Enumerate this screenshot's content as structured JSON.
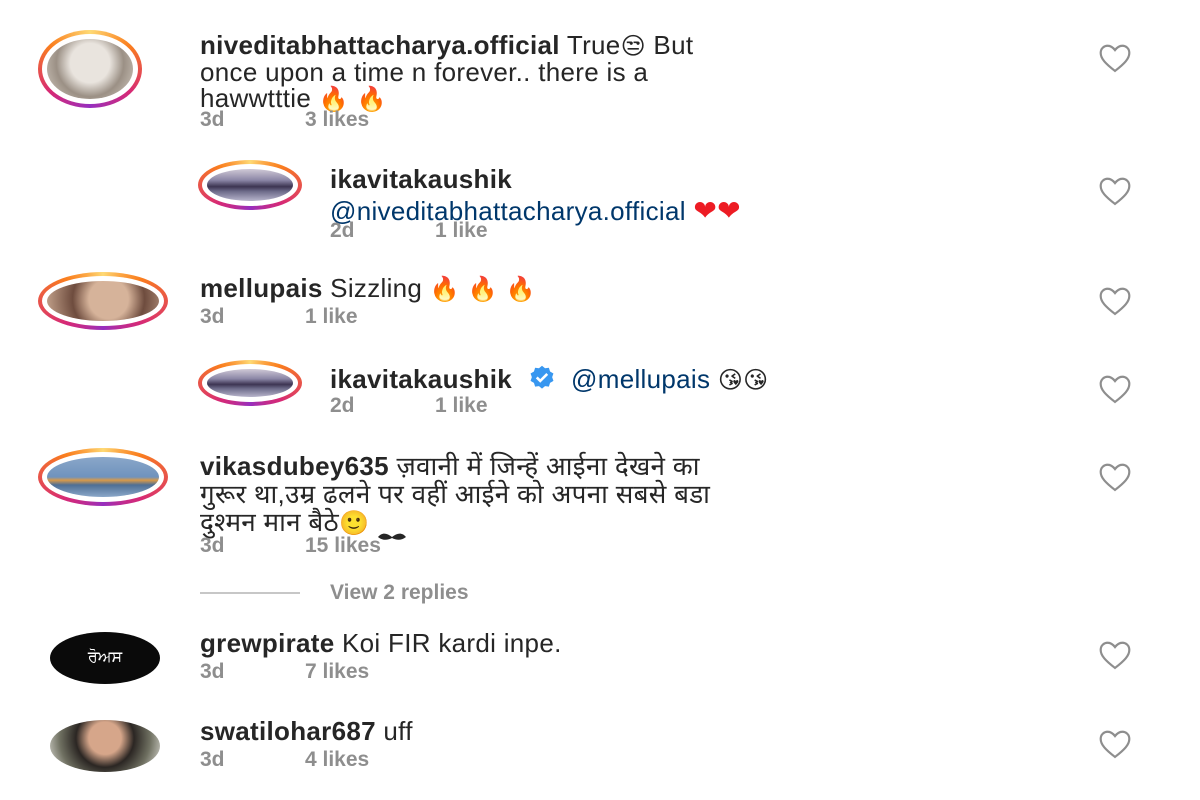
{
  "comments": [
    {
      "username": "niveditabhattacharya.official",
      "text_line1": "True",
      "emoji1": "😒",
      "text_line1b": " But",
      "text_line2": "once upon a time n forever.. there is a",
      "text_line3": "hawwtttie",
      "emoji3": "🔥 🔥",
      "time": "3d",
      "likes": "3 likes"
    },
    {
      "username": "ikavitakaushik",
      "mention": "@niveditabhattacharya.official",
      "emoji": "❤❤",
      "time": "2d",
      "likes": "1 like"
    },
    {
      "username": "mellupais",
      "text": "Sizzling",
      "emoji": "🔥 🔥 🔥",
      "time": "3d",
      "likes": "1 like"
    },
    {
      "username": "ikavitakaushik",
      "mention": "@mellupais",
      "emoji": "😘😘",
      "time": "2d",
      "likes": "1 like"
    },
    {
      "username": "vikasdubey635",
      "text_line1": " ज़वानी में जिन्हें आईना देखने का",
      "text_line2": "गुरूर था,उम्र ढलने पर वहीं आईने को अपना सबसे बडा",
      "text_line3": "दुश्मन मान बैठे",
      "emoji3": "🙂",
      "time": "3d",
      "likes": "15 likes"
    },
    {
      "username": "grewpirate",
      "text": "Koi FIR kardi inpe.",
      "avatar_text": "ਰੋਅਸ",
      "time": "3d",
      "likes": "7 likes"
    },
    {
      "username": "swatilohar687",
      "text": "uff",
      "time": "3d",
      "likes": "4 likes"
    }
  ],
  "view_replies": "View 2 replies",
  "colors": {
    "accent": "#0095f6",
    "muted": "#8e8e8e",
    "mention": "#00376b",
    "heart_red": "#ed1c24"
  },
  "icons": {
    "like": "heart-outline-icon",
    "verified": "verified-badge-icon",
    "flame": "fire-emoji"
  }
}
